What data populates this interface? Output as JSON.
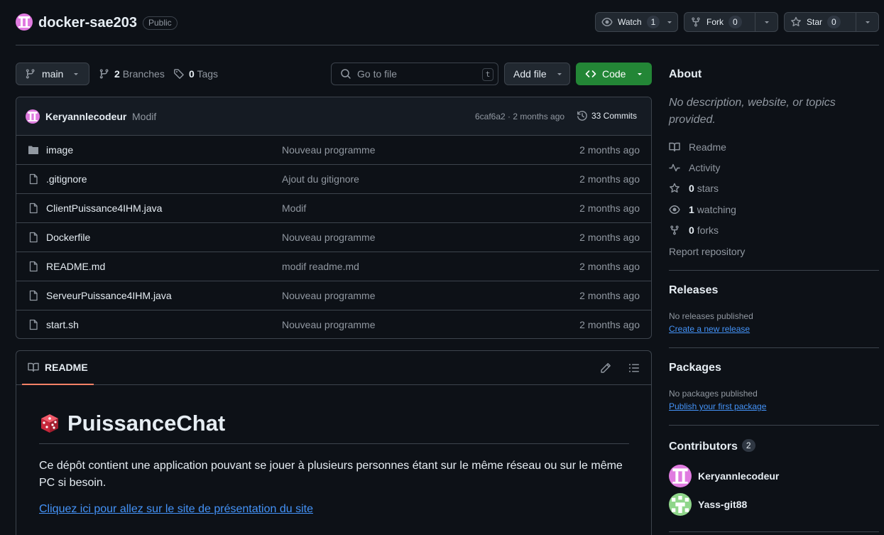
{
  "repo": {
    "name": "docker-sae203",
    "visibility": "Public"
  },
  "header_buttons": {
    "watch": {
      "label": "Watch",
      "count": "1"
    },
    "fork": {
      "label": "Fork",
      "count": "0"
    },
    "star": {
      "label": "Star",
      "count": "0"
    }
  },
  "toolbar": {
    "branch": "main",
    "branches_count": "2",
    "branches_label": "Branches",
    "tags_count": "0",
    "tags_label": "Tags",
    "goto_placeholder": "Go to file",
    "goto_shortcut": "t",
    "add_file": "Add file",
    "code": "Code"
  },
  "commit": {
    "author": "Keryannlecodeur",
    "message": "Modif",
    "hash_time": "6caf6a2 · 2 months ago",
    "commits_label": "33 Commits"
  },
  "files": [
    {
      "name": "image",
      "type": "folder",
      "message": "Nouveau programme",
      "date": "2 months ago"
    },
    {
      "name": ".gitignore",
      "type": "file",
      "message": "Ajout du gitignore",
      "date": "2 months ago"
    },
    {
      "name": "ClientPuissance4IHM.java",
      "type": "file",
      "message": "Modif",
      "date": "2 months ago"
    },
    {
      "name": "Dockerfile",
      "type": "file",
      "message": "Nouveau programme",
      "date": "2 months ago"
    },
    {
      "name": "README.md",
      "type": "file",
      "message": "modif readme.md",
      "date": "2 months ago"
    },
    {
      "name": "ServeurPuissance4IHM.java",
      "type": "file",
      "message": "Nouveau programme",
      "date": "2 months ago"
    },
    {
      "name": "start.sh",
      "type": "file",
      "message": "Nouveau programme",
      "date": "2 months ago"
    }
  ],
  "readme": {
    "tab": "README",
    "title": "PuissanceChat",
    "paragraph": "Ce dépôt contient une application pouvant se jouer à plusieurs personnes étant sur le même réseau ou sur le même PC si besoin.",
    "link": "Cliquez ici pour allez sur le site de présentation du site"
  },
  "about": {
    "title": "About",
    "description": "No description, website, or topics provided.",
    "readme": "Readme",
    "activity": "Activity",
    "stars_count": "0",
    "stars_label": "stars",
    "watching_count": "1",
    "watching_label": "watching",
    "forks_count": "0",
    "forks_label": "forks",
    "report": "Report repository"
  },
  "releases": {
    "title": "Releases",
    "none": "No releases published",
    "link": "Create a new release"
  },
  "packages": {
    "title": "Packages",
    "none": "No packages published",
    "link": "Publish your first package"
  },
  "contributors": {
    "title": "Contributors",
    "count": "2",
    "list": [
      {
        "name": "Keryannlecodeur",
        "color": "#e07be0"
      },
      {
        "name": "Yass-git88",
        "color": "#8fd68a"
      }
    ]
  },
  "colors": {
    "accent_green": "#238636",
    "link_blue": "#4493f8",
    "tab_underline": "#f78166"
  }
}
